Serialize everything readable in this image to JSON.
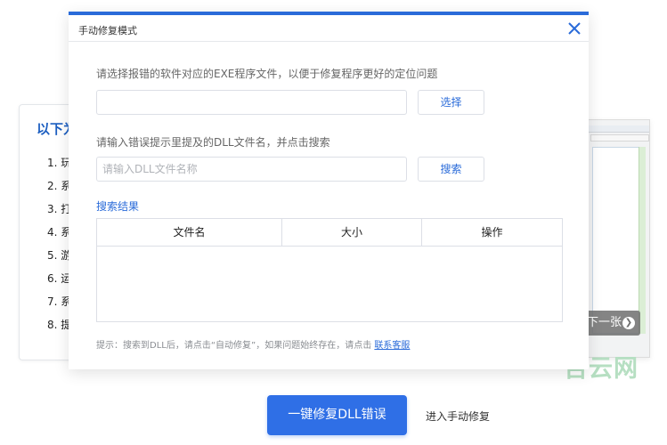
{
  "background": {
    "left_card": {
      "title": "以下为",
      "items": [
        "1. 玩",
        "2. 系",
        "3. 打",
        "4. 系",
        "5. 游",
        "6. 运",
        "7. 系",
        "8. 提"
      ]
    },
    "next_button": {
      "label": "下一张",
      "icon": "chevron-right-icon"
    },
    "watermark": "吉云网"
  },
  "modal": {
    "title": "手动修复模式",
    "close_icon": "close-icon",
    "exe_prompt": "请选择报错的软件对应的EXE程序文件，以便于修复程序更好的定位问题",
    "exe_input": {
      "value": "",
      "placeholder": ""
    },
    "select_button": "选择",
    "dll_prompt": "请输入错误提示里提及的DLL文件名，并点击搜索",
    "dll_input": {
      "value": "",
      "placeholder": "请输入DLL文件名称"
    },
    "search_button": "搜索",
    "results_title": "搜索结果",
    "table": {
      "columns": [
        "文件名",
        "大小",
        "操作"
      ],
      "rows": []
    },
    "tip_text": "提示：搜索到DLL后，请点击“自动修复”，如果问题始终存在，请点击",
    "tip_link": "联系客服"
  },
  "footer": {
    "primary_button": "一键修复DLL错误",
    "secondary_link": "进入手动修复"
  },
  "colors": {
    "accent": "#2a6bd9",
    "primary_button": "#2f6fe6",
    "watermark": "#b6dfc2"
  }
}
